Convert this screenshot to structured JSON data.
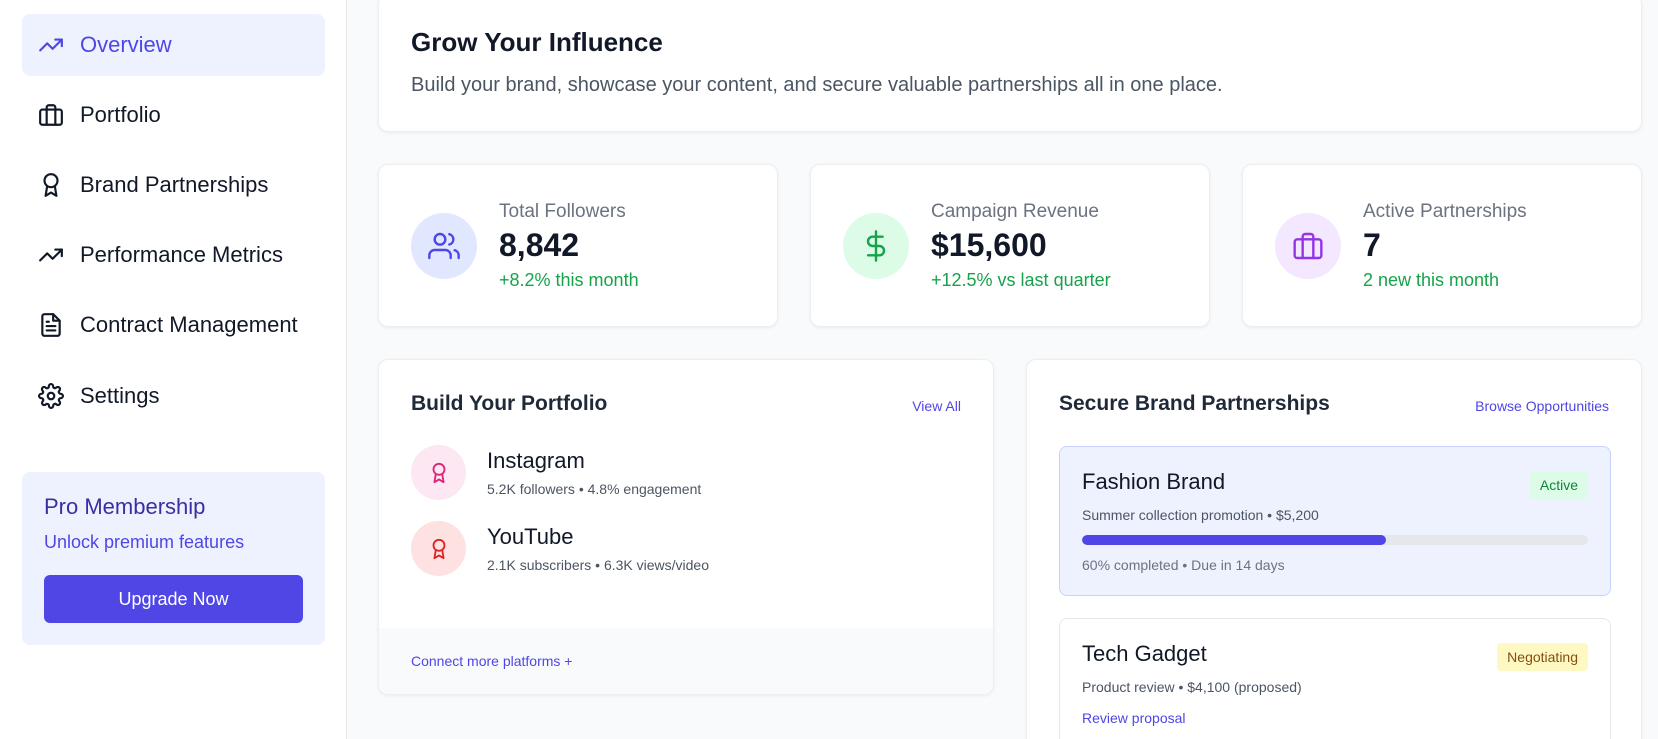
{
  "sidebar": {
    "items": [
      {
        "label": "Overview",
        "icon": "trending-up-icon"
      },
      {
        "label": "Portfolio",
        "icon": "briefcase-icon"
      },
      {
        "label": "Brand Partnerships",
        "icon": "award-icon"
      },
      {
        "label": "Performance Metrics",
        "icon": "trending-up-icon"
      },
      {
        "label": "Contract Management",
        "icon": "file-text-icon"
      },
      {
        "label": "Settings",
        "icon": "gear-icon"
      }
    ],
    "active": "Overview"
  },
  "pro": {
    "title": "Pro Membership",
    "subtitle": "Unlock premium features",
    "button": "Upgrade Now"
  },
  "hero": {
    "title": "Grow Your Influence",
    "subtitle": "Build your brand, showcase your content, and secure valuable partnerships all in one place."
  },
  "stats": [
    {
      "label": "Total Followers",
      "value": "8,842",
      "change": "+8.2% this month",
      "icon": "users-icon",
      "color": "#4f46e5",
      "bg": "#e0e7ff"
    },
    {
      "label": "Campaign Revenue",
      "value": "$15,600",
      "change": "+12.5% vs last quarter",
      "icon": "dollar-icon",
      "color": "#16a34a",
      "bg": "#dcfce7"
    },
    {
      "label": "Active Partnerships",
      "value": "7",
      "change": "2 new this month",
      "icon": "briefcase-icon",
      "color": "#9333ea",
      "bg": "#f3e8ff"
    }
  ],
  "portfolio": {
    "title": "Build Your Portfolio",
    "view_all": "View All",
    "platforms": [
      {
        "name": "Instagram",
        "stats": "5.2K followers • 4.8% engagement",
        "icon": "award-icon",
        "color": "#db2777",
        "bg": "#fce7f3"
      },
      {
        "name": "YouTube",
        "stats": "2.1K subscribers • 6.3K views/video",
        "icon": "award-icon",
        "color": "#dc2626",
        "bg": "#fee2e2"
      }
    ],
    "connect": "Connect more platforms +"
  },
  "partnerships": {
    "title": "Secure Brand Partnerships",
    "browse": "Browse Opportunities",
    "deals": [
      {
        "name": "Fashion Brand",
        "status": "Active",
        "status_color": "#15803d",
        "status_bg": "#dcfce7",
        "description": "Summer collection promotion • $5,200",
        "progress": 0.6,
        "meta": "60% completed • Due in 14 days"
      },
      {
        "name": "Tech Gadget",
        "status": "Negotiating",
        "status_color": "#854d0e",
        "status_bg": "#fef9c3",
        "description": "Product review • $4,100 (proposed)",
        "action": "Review proposal"
      }
    ]
  },
  "colors": {
    "accent": "#4f46e5",
    "success": "#16a34a"
  }
}
